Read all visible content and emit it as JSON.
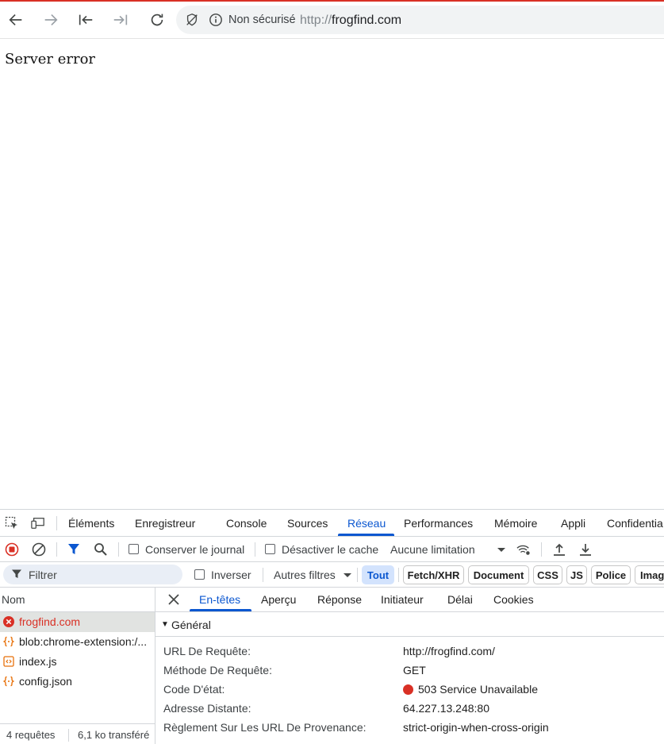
{
  "browser": {
    "security_label": "Non sécurisé",
    "url_scheme": "http://",
    "url_host": "frogfind.com"
  },
  "page": {
    "body_text": "Server error"
  },
  "devtools": {
    "tabs": [
      "Éléments",
      "Enregistreur",
      "Console",
      "Sources",
      "Réseau",
      "Performances",
      "Mémoire",
      "Appli",
      "Confidentia"
    ],
    "active_tab": "Réseau",
    "network": {
      "preserve_log_label": "Conserver le journal",
      "disable_cache_label": "Désactiver le cache",
      "throttling_value": "Aucune limitation",
      "filter_placeholder": "Filtrer",
      "invert_label": "Inverser",
      "more_filters_label": "Autres filtres",
      "filter_chips": [
        "Tout",
        "Fetch/XHR",
        "Document",
        "CSS",
        "JS",
        "Police",
        "Imag"
      ],
      "active_chip": "Tout",
      "name_column": "Nom",
      "requests": [
        {
          "name": "frogfind.com",
          "status": "error",
          "icon": "error-circle-icon"
        },
        {
          "name": "blob:chrome-extension:/...",
          "status": "ok",
          "icon": "json-braces-icon"
        },
        {
          "name": "index.js",
          "status": "ok",
          "icon": "script-icon"
        },
        {
          "name": "config.json",
          "status": "ok",
          "icon": "json-braces-icon"
        }
      ],
      "summary_requests": "4 requêtes",
      "summary_transferred": "6,1 ko transféré"
    },
    "details": {
      "tabs": [
        "En-têtes",
        "Aperçu",
        "Réponse",
        "Initiateur",
        "Délai",
        "Cookies"
      ],
      "active_tab": "En-têtes",
      "section_title": "Général",
      "rows": [
        {
          "key": "URL De Requête:",
          "value": "http://frogfind.com/"
        },
        {
          "key": "Méthode De Requête:",
          "value": "GET"
        },
        {
          "key": "Code D'état:",
          "value": "503 Service Unavailable"
        },
        {
          "key": "Adresse Distante:",
          "value": "64.227.13.248:80"
        },
        {
          "key": "Règlement Sur Les URL De Provenance:",
          "value": "strict-origin-when-cross-origin"
        }
      ]
    }
  },
  "colors": {
    "accent": "#0b57d0",
    "error": "#d93025"
  }
}
